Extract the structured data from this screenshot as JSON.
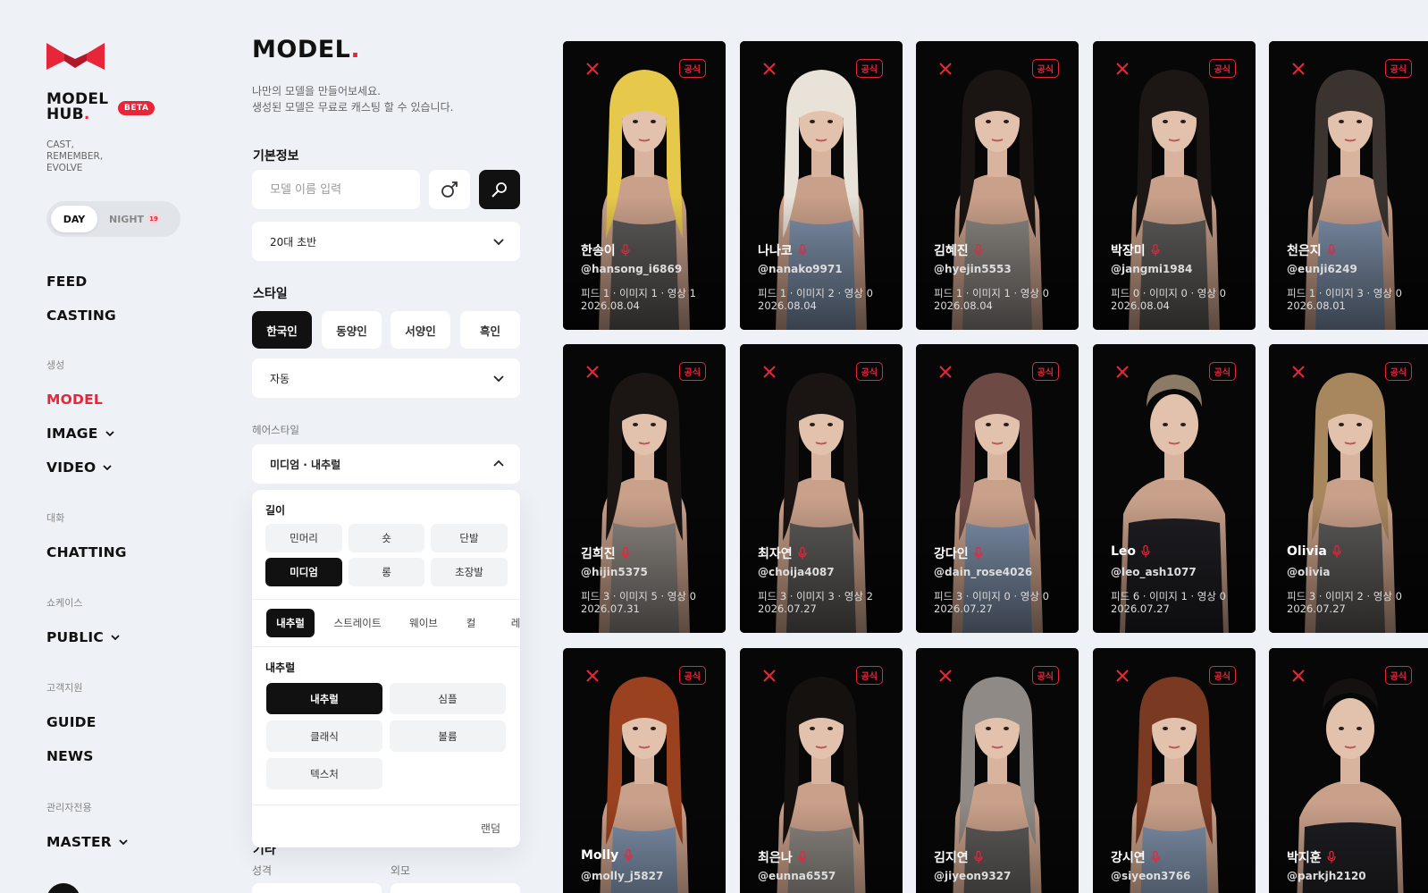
{
  "brand": {
    "name_line1": "MODEL",
    "name_line2": "HUB",
    "badge": "BETA",
    "tagline": "CAST, REMEMBER, EVOLVE",
    "accent": "#e8263a"
  },
  "theme": {
    "day": "DAY",
    "night": "NIGHT",
    "night_badge": "19"
  },
  "nav": {
    "feed": "FEED",
    "casting": "CASTING",
    "section_create": "생성",
    "model": "MODEL",
    "image": "IMAGE",
    "video": "VIDEO",
    "section_chat": "대화",
    "chatting": "CHATTING",
    "section_showcase": "쇼케이스",
    "public": "PUBLIC",
    "section_support": "고객지원",
    "guide": "GUIDE",
    "news": "NEWS",
    "section_admin": "관리자전용",
    "master": "MASTER"
  },
  "form": {
    "title": "MODEL",
    "intro_line1": "나만의 모델을 만들어보세요.",
    "intro_line2": "생성된 모델은 무료로 캐스팅 할 수 있습니다.",
    "basic_info": "기본정보",
    "name_placeholder": "모델 이름 입력",
    "age_select": "20대 초반",
    "style_title": "스타일",
    "styles": [
      "한국인",
      "동양인",
      "서양인",
      "흑인"
    ],
    "style_active": "한국인",
    "style_select": "자동",
    "hair_label": "헤어스타일",
    "hair_select": "미디엄 · 내추럴",
    "length_label": "길이",
    "lengths": [
      "민머리",
      "숏",
      "단발",
      "미디엄",
      "롱",
      "초장발"
    ],
    "length_active": "미디엄",
    "types": [
      "내추럴",
      "스트레이트",
      "웨이브",
      "컬",
      "레"
    ],
    "type_active": "내추럴",
    "subtype_label": "내추럴",
    "subtypes": [
      "내추럴",
      "심플",
      "클래식",
      "볼륨",
      "텍스처"
    ],
    "subtype_active": "내추럴",
    "random": "랜덤",
    "other_title": "기타",
    "personality": "성격",
    "appearance": "외모"
  },
  "cards": [
    {
      "name": "한송이",
      "handle": "@hansong_i6869",
      "stats": "피드 1 · 이미지 1 · 영상 1",
      "date": "2026.08.04",
      "badge": "공식",
      "hair": "#e6c84a"
    },
    {
      "name": "나나코",
      "handle": "@nanako9971",
      "stats": "피드 1 · 이미지 2 · 영상 0",
      "date": "2026.08.04",
      "badge": "공식",
      "hair": "#e8e2d8"
    },
    {
      "name": "김혜진",
      "handle": "@hyejin5553",
      "stats": "피드 1 · 이미지 1 · 영상 0",
      "date": "2026.08.04",
      "badge": "공식",
      "hair": "#1a1412"
    },
    {
      "name": "박장미",
      "handle": "@jangmi1984",
      "stats": "피드 0 · 이미지 0 · 영상 0",
      "date": "2026.08.04",
      "badge": "공식",
      "hair": "#1c1714"
    },
    {
      "name": "천은지",
      "handle": "@eunji6249",
      "stats": "피드 1 · 이미지 3 · 영상 0",
      "date": "2026.08.01",
      "badge": "공식",
      "hair": "#3a3330"
    },
    {
      "name": "김희진",
      "handle": "@hijin5375",
      "stats": "피드 3 · 이미지 5 · 영상 0",
      "date": "2026.07.31",
      "badge": "공식",
      "hair": "#1b1614"
    },
    {
      "name": "최자연",
      "handle": "@choija4087",
      "stats": "피드 3 · 이미지 3 · 영상 2",
      "date": "2026.07.27",
      "badge": "공식",
      "hair": "#1a1513"
    },
    {
      "name": "강다인",
      "handle": "@dain_rose4026",
      "stats": "피드 3 · 이미지 0 · 영상 0",
      "date": "2026.07.27",
      "badge": "공식",
      "hair": "#6e4a44"
    },
    {
      "name": "Leo",
      "handle": "@leo_ash1077",
      "stats": "피드 6 · 이미지 1 · 영상 0",
      "date": "2026.07.27",
      "badge": "공식",
      "hair": "#8a7a66"
    },
    {
      "name": "Olivia",
      "handle": "@olivia",
      "stats": "피드 3 · 이미지 2 · 영상 0",
      "date": "2026.07.27",
      "badge": "공식",
      "hair": "#a8875e"
    },
    {
      "name": "Molly",
      "handle": "@molly_j5827",
      "stats": "",
      "date": "",
      "badge": "공식",
      "hair": "#9a4220"
    },
    {
      "name": "최은나",
      "handle": "@eunna6557",
      "stats": "",
      "date": "",
      "badge": "공식",
      "hair": "#15110f"
    },
    {
      "name": "김지연",
      "handle": "@jiyeon9327",
      "stats": "",
      "date": "",
      "badge": "공식",
      "hair": "#8f8a86"
    },
    {
      "name": "강시연",
      "handle": "@siyeon3766",
      "stats": "",
      "date": "",
      "badge": "공식",
      "hair": "#7a3a22"
    },
    {
      "name": "박지훈",
      "handle": "@parkjh2120",
      "stats": "",
      "date": "",
      "badge": "공식",
      "hair": "#141110"
    }
  ]
}
